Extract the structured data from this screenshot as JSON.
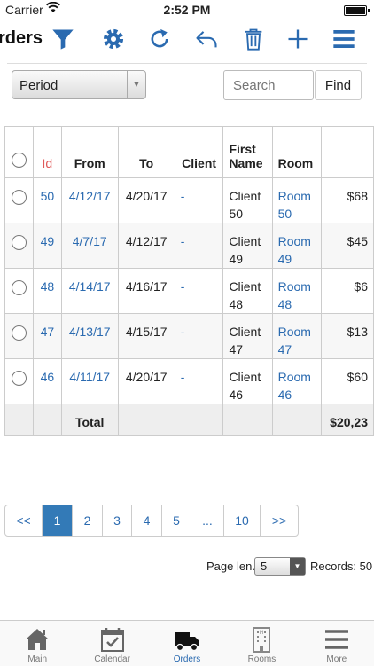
{
  "status": {
    "carrier": "Carrier",
    "time": "2:52 PM"
  },
  "nav": {
    "title": "rders"
  },
  "filters": {
    "period": "Period",
    "search_placeholder": "Search",
    "find": "Find"
  },
  "table": {
    "headers": {
      "id": "Id",
      "from": "From",
      "to": "To",
      "client": "Client",
      "first_name": "First Name",
      "room": "Room"
    },
    "rows": [
      {
        "id": "50",
        "from": "4/12/17",
        "to": "4/20/17",
        "client": "-",
        "first_name": "Client 50",
        "room": "Room 50",
        "amount": "$68"
      },
      {
        "id": "49",
        "from": "4/7/17",
        "to": "4/12/17",
        "client": "-",
        "first_name": "Client 49",
        "room": "Room 49",
        "amount": "$45"
      },
      {
        "id": "48",
        "from": "4/14/17",
        "to": "4/16/17",
        "client": "-",
        "first_name": "Client 48",
        "room": "Room 48",
        "amount": "$6"
      },
      {
        "id": "47",
        "from": "4/13/17",
        "to": "4/15/17",
        "client": "-",
        "first_name": "Client 47",
        "room": "Room 47",
        "amount": "$13"
      },
      {
        "id": "46",
        "from": "4/11/17",
        "to": "4/20/17",
        "client": "-",
        "first_name": "Client 46",
        "room": "Room 46",
        "amount": "$60"
      }
    ],
    "total_label": "Total",
    "total_amount": "$20,23"
  },
  "pagination": {
    "pages": [
      "<<",
      "1",
      "2",
      "3",
      "4",
      "5",
      "...",
      "10",
      ">>"
    ],
    "active": "1"
  },
  "footer": {
    "page_len_label": "Page len.",
    "page_len": "5",
    "records": "Records: 50"
  },
  "tabs": [
    {
      "label": "Main",
      "icon": "home-icon"
    },
    {
      "label": "Calendar",
      "icon": "calendar-icon"
    },
    {
      "label": "Orders",
      "icon": "truck-icon"
    },
    {
      "label": "Rooms",
      "icon": "building-icon"
    },
    {
      "label": "More",
      "icon": "menu-icon"
    }
  ],
  "colors": {
    "accent": "#2a6ab0",
    "id_header": "#e05a5a",
    "active_page": "#337ab7"
  }
}
